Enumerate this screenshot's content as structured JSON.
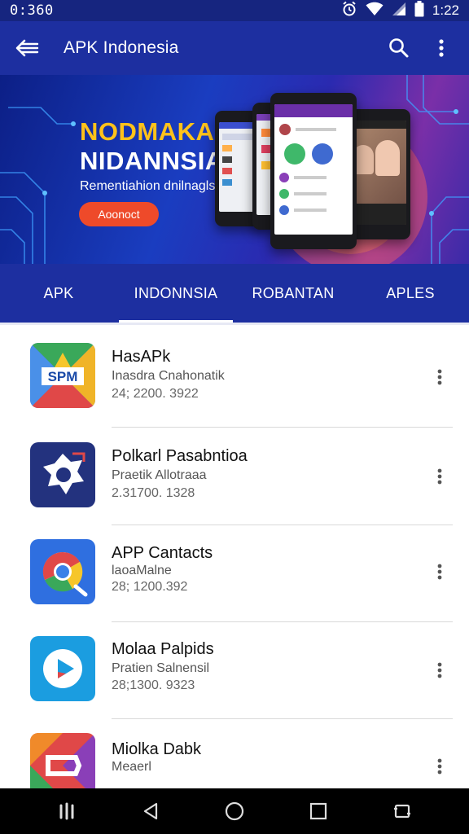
{
  "status_bar": {
    "time_left": "0:360",
    "time_right": "1:22",
    "icons": [
      "alarm-icon",
      "wifi-icon",
      "signal-icon",
      "battery-icon"
    ]
  },
  "app_bar": {
    "title": "APK Indonesia",
    "icons": [
      "back-arrow-icon",
      "search-icon",
      "more-vert-icon"
    ]
  },
  "banner": {
    "headline_1": "NODMAKA",
    "headline_2": "NIDANNSIA",
    "subline": "Rementiahion dnilnagls",
    "cta_label": "Aoonoct",
    "colors": {
      "headline_1": "#ffc21a",
      "cta": "#ee4a2a"
    }
  },
  "tabs": [
    {
      "label": "APK",
      "active": false
    },
    {
      "label": "INDONNSIA",
      "active": true
    },
    {
      "label": "ROBANTAN",
      "active": false
    },
    {
      "label": "APLES",
      "active": false
    }
  ],
  "apps": [
    {
      "name": "HasAPk",
      "developer": "Inasdra Cnahonatik",
      "meta": "24; 2200. 3922",
      "icon": "hasapk-icon"
    },
    {
      "name": "Polkarl Pasabntioa",
      "developer": "Praetik Allotraaa",
      "meta": "2.31700. 1328",
      "icon": "polkarl-icon"
    },
    {
      "name": "APP Cantacts",
      "developer": "laoaMalne",
      "meta": "28; 1200.392",
      "icon": "app-contacts-icon"
    },
    {
      "name": "Molaa Palpids",
      "developer": "Pratien Salnensil",
      "meta": "28;1300. 9323",
      "icon": "molaa-play-icon"
    },
    {
      "name": "Miolka Dabk",
      "developer": "Meaerl",
      "meta": "",
      "icon": "miolka-icon"
    }
  ],
  "nav_bar": {
    "icons": [
      "recents-lines-icon",
      "back-triangle-icon",
      "home-circle-icon",
      "overview-square-icon",
      "rotate-icon"
    ]
  },
  "colors": {
    "primary": "#1d2fa0",
    "status_bar": "#16257f"
  }
}
